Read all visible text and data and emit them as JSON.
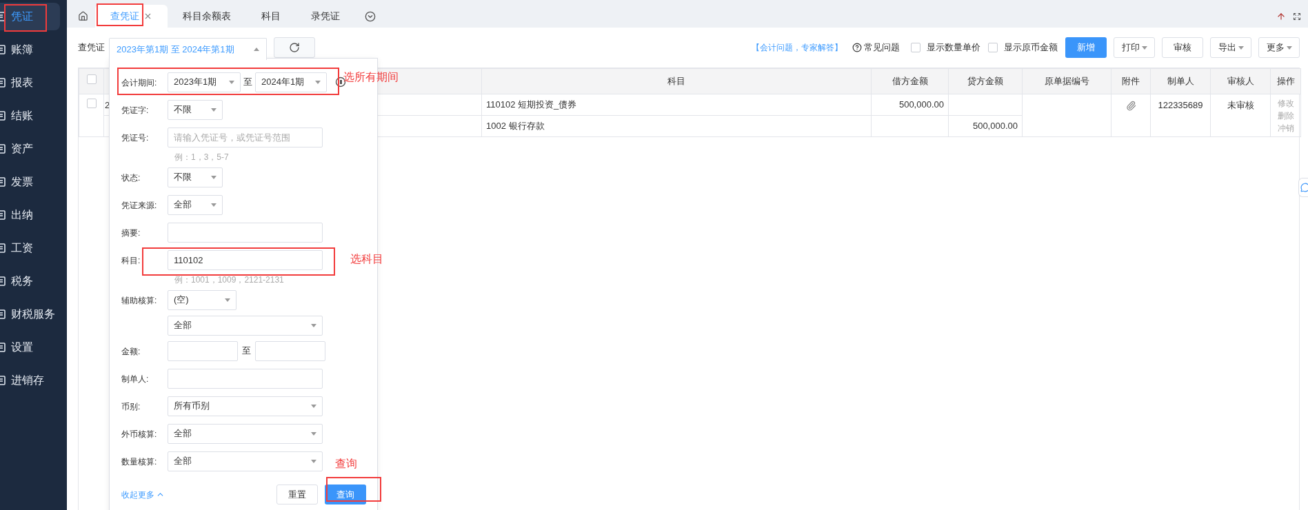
{
  "sidebar": {
    "items": [
      {
        "label": "凭证",
        "selected": true
      },
      {
        "label": "账簿",
        "selected": false
      },
      {
        "label": "报表",
        "selected": false
      },
      {
        "label": "结账",
        "selected": false
      },
      {
        "label": "资产",
        "selected": false
      },
      {
        "label": "发票",
        "selected": false
      },
      {
        "label": "出纳",
        "selected": false
      },
      {
        "label": "工资",
        "selected": false
      },
      {
        "label": "税务",
        "selected": false
      },
      {
        "label": "财税服务",
        "selected": false
      },
      {
        "label": "设置",
        "selected": false
      },
      {
        "label": "进销存",
        "selected": false
      }
    ]
  },
  "tabs": [
    {
      "label": "查凭证",
      "selected": true,
      "closable": true
    },
    {
      "label": "科目余额表",
      "selected": false,
      "closable": false
    },
    {
      "label": "科目",
      "selected": false,
      "closable": false
    },
    {
      "label": "录凭证",
      "selected": false,
      "closable": false
    }
  ],
  "toolbar": {
    "title": "查凭证",
    "period": "2023年第1期 至 2024年第1期",
    "expert_link": "【会计问题，专家解答】",
    "faq": "常见问题",
    "checkboxes": [
      {
        "label": "显示数量单价",
        "checked": false
      },
      {
        "label": "显示原币金额",
        "checked": false
      }
    ],
    "buttons": [
      {
        "label": "新增",
        "kind": "primary"
      },
      {
        "label": "打印",
        "kind": "dropdown"
      },
      {
        "label": "审核",
        "kind": "plain"
      },
      {
        "label": "导出",
        "kind": "dropdown"
      },
      {
        "label": "更多",
        "kind": "dropdown"
      }
    ]
  },
  "table": {
    "header_checked": false,
    "columns": [
      {
        "kind": "checkbox"
      },
      {
        "kind": "blank"
      },
      {
        "kind": "text",
        "label": "科目"
      },
      {
        "kind": "text",
        "label": "借方金额"
      },
      {
        "kind": "text",
        "label": "贷方金额"
      },
      {
        "kind": "text",
        "label": "原单据编号"
      },
      {
        "kind": "text",
        "label": "附件"
      },
      {
        "kind": "text",
        "label": "制单人"
      },
      {
        "kind": "text",
        "label": "审核人"
      },
      {
        "kind": "text",
        "label": "操作"
      }
    ],
    "vouchers": [
      {
        "checked": false,
        "has_attachment": true,
        "maker": "122335689",
        "reviewer": "未审核",
        "actions": [
          "修改",
          "删除",
          "冲销"
        ],
        "lines": [
          {
            "column_2": "2",
            "subject": "110102 短期投资_债券",
            "debit": "500,000.00"
          },
          {
            "subject": "1002 银行存款",
            "credit": "500,000.00"
          }
        ]
      }
    ]
  },
  "filter": {
    "fields": [
      {
        "kind": "range-select",
        "label": "会计期间:",
        "from": "2023年1期",
        "separator": "至",
        "to": "2024年1期"
      },
      {
        "kind": "short-select",
        "label": "凭证字:",
        "value": "不限"
      },
      {
        "kind": "input",
        "label": "凭证号:",
        "placeholder": "请输入凭证号，或凭证号范围",
        "hint": "例：1，3，5-7"
      },
      {
        "kind": "short-select",
        "label": "状态:",
        "value": "不限"
      },
      {
        "kind": "short-select",
        "label": "凭证来源:",
        "value": "全部"
      },
      {
        "kind": "input",
        "label": "摘要:"
      },
      {
        "kind": "input",
        "label": "科目:",
        "value": "110102",
        "hint": "例：1001，1009，2121-2131"
      },
      {
        "kind": "medium-select",
        "label": "辅助核算:",
        "value": "(空)"
      },
      {
        "kind": "wide-select",
        "value": "全部"
      },
      {
        "kind": "range-input",
        "label": "金额:",
        "separator": "至"
      },
      {
        "kind": "input",
        "label": "制单人:"
      },
      {
        "kind": "wide-select",
        "label": "币别:",
        "value": "所有币别"
      },
      {
        "kind": "wide-select",
        "label": "外币核算:",
        "value": "全部"
      },
      {
        "kind": "wide-select",
        "label": "数量核算:",
        "value": "全部"
      }
    ],
    "collapse_link": "收起更多",
    "buttons": [
      {
        "label": "重置",
        "kind": "plain"
      },
      {
        "label": "查询",
        "kind": "primary"
      }
    ]
  },
  "annotations": [
    {
      "text": "选所有期间"
    },
    {
      "text": "选科目"
    },
    {
      "text": "查询"
    }
  ]
}
